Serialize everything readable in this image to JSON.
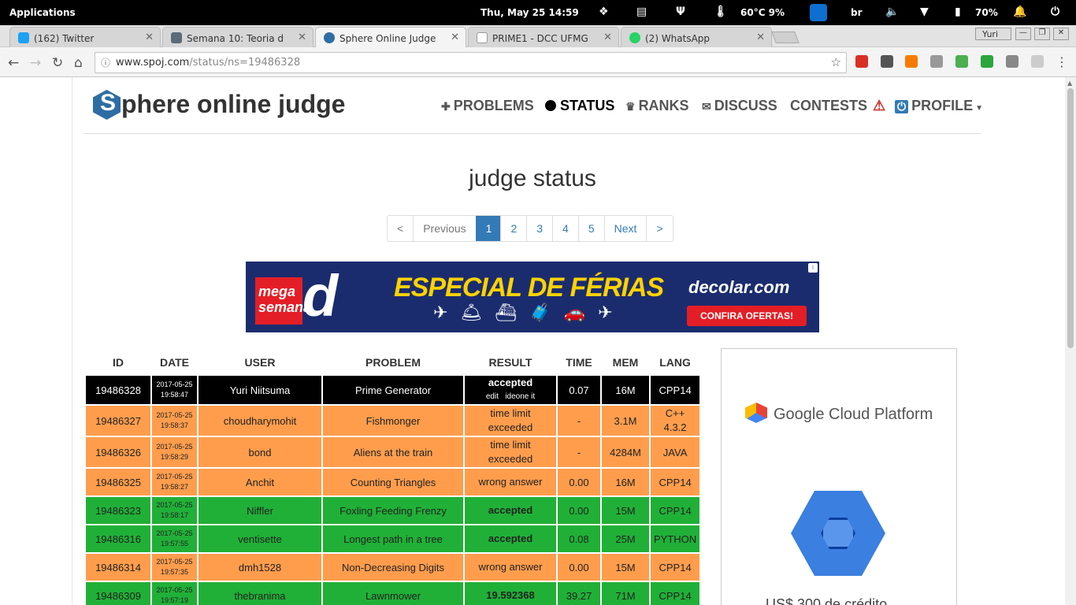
{
  "system": {
    "apps": "Applications",
    "clock": "Thu, May 25  14:59",
    "temp": "60°C 9%",
    "keyboard": "br",
    "battery": "70%"
  },
  "tabs": [
    {
      "title": "(162) Twitter",
      "icon": "twitter-icon",
      "color": "#1da1f2"
    },
    {
      "title": "Semana 10: Teoria d",
      "icon": "trello-icon",
      "color": "#5b6b7a"
    },
    {
      "title": "Sphere Online Judge",
      "icon": "spoj-icon",
      "color": "#2e6da4"
    },
    {
      "title": "PRIME1 - DCC UFMG",
      "icon": "page-icon",
      "color": "#999999"
    },
    {
      "title": "(2) WhatsApp",
      "icon": "whatsapp-icon",
      "color": "#25d366"
    }
  ],
  "window": {
    "user": "Yuri"
  },
  "url": {
    "host": "www.spoj.com",
    "path": "/status/ns=19486328"
  },
  "site": {
    "logo_s": "S",
    "logo_rest": "phere online judge",
    "nav": {
      "problems": "PROBLEMS",
      "status": "STATUS",
      "ranks": "RANKS",
      "discuss": "DISCUSS",
      "contests": "CONTESTS",
      "profile": "PROFILE"
    }
  },
  "heading": "judge status",
  "pager": {
    "first": "<",
    "prev": "Previous",
    "pages": [
      "1",
      "2",
      "3",
      "4",
      "5"
    ],
    "next": "Next",
    "last": ">"
  },
  "ad": {
    "mega": "mega semana",
    "letter": "d",
    "headline": "ESPECIAL DE FÉRIAS",
    "brand": "decolar.com",
    "cta": "CONFIRA OFERTAS!",
    "info": "i"
  },
  "table": {
    "headers": [
      "ID",
      "DATE",
      "USER",
      "PROBLEM",
      "RESULT",
      "TIME",
      "MEM",
      "LANG"
    ],
    "rows": [
      {
        "id": "19486328",
        "date": "2017-05-25",
        "time_of_day": "19:58:47",
        "user": "Yuri Niitsuma",
        "problem": "Prime Generator",
        "result": "accepted",
        "sub1": "edit",
        "sub2": "ideone it",
        "time": "0.07",
        "mem": "16M",
        "lang": "CPP14",
        "status_color": "#000000"
      },
      {
        "id": "19486327",
        "date": "2017-05-25",
        "time_of_day": "19:58:37",
        "user": "choudharymohit",
        "problem": "Fishmonger",
        "result": "time limit exceeded",
        "time": "-",
        "mem": "3.1M",
        "lang": "C++ 4.3.2",
        "status_color": "#ff9d4d"
      },
      {
        "id": "19486326",
        "date": "2017-05-25",
        "time_of_day": "19:58:29",
        "user": "bond",
        "problem": "Aliens at the train",
        "result": "time limit exceeded",
        "time": "-",
        "mem": "4284M",
        "lang": "JAVA",
        "status_color": "#ff9d4d"
      },
      {
        "id": "19486325",
        "date": "2017-05-25",
        "time_of_day": "19:58:27",
        "user": "Anchit",
        "problem": "Counting Triangles",
        "result": "wrong answer",
        "time": "0.00",
        "mem": "16M",
        "lang": "CPP14",
        "status_color": "#ff9d4d"
      },
      {
        "id": "19486323",
        "date": "2017-05-25",
        "time_of_day": "19:58:17",
        "user": "Niffler",
        "problem": "Foxling Feeding Frenzy",
        "result": "accepted",
        "time": "0.00",
        "mem": "15M",
        "lang": "CPP14",
        "status_color": "#20b037"
      },
      {
        "id": "19486316",
        "date": "2017-05-25",
        "time_of_day": "19:57:55",
        "user": "ventisette",
        "problem": "Longest path in a tree",
        "result": "accepted",
        "time": "0.08",
        "mem": "25M",
        "lang": "PYTHON",
        "status_color": "#20b037"
      },
      {
        "id": "19486314",
        "date": "2017-05-25",
        "time_of_day": "19:57:35",
        "user": "dmh1528",
        "problem": "Non-Decreasing Digits",
        "result": "wrong answer",
        "time": "0.00",
        "mem": "15M",
        "lang": "CPP14",
        "status_color": "#ff9d4d"
      },
      {
        "id": "19486309",
        "date": "2017-05-25",
        "time_of_day": "19:57:19",
        "user": "thebranima",
        "problem": "Lawnmower",
        "result": "19.592368",
        "time": "39.27",
        "mem": "71M",
        "lang": "CPP14",
        "status_color": "#20b037"
      }
    ]
  },
  "side_ad": {
    "brand": "Google Cloud Platform",
    "credit": "US$ 300 de crédito"
  }
}
